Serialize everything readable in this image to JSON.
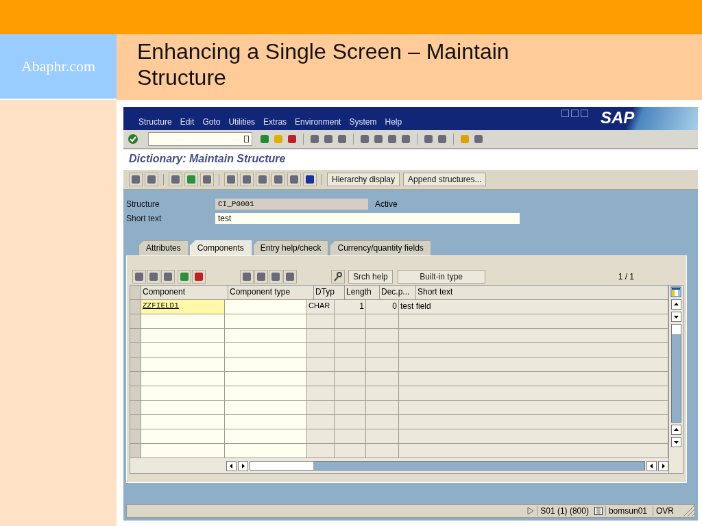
{
  "slide": {
    "site_label": "Abaphr.com",
    "title": "Enhancing a Single Screen – Maintain Structure"
  },
  "sap": {
    "menu": [
      "Structure",
      "Edit",
      "Goto",
      "Utilities",
      "Extras",
      "Environment",
      "System",
      "Help"
    ],
    "logo": "SAP",
    "screen_title": "Dictionary: Maintain Structure",
    "app_buttons": [
      "Hierarchy display",
      "Append structures..."
    ],
    "fields": [
      {
        "label": "Structure",
        "value": "CI_P0001",
        "kind": "readonly",
        "status": "Active"
      },
      {
        "label": "Short text",
        "value": "test",
        "kind": "input"
      }
    ],
    "tabs": [
      {
        "label": "Attributes",
        "selected": false
      },
      {
        "label": "Components",
        "selected": true
      },
      {
        "label": "Entry help/check",
        "selected": false
      },
      {
        "label": "Currency/quantity fields",
        "selected": false
      }
    ],
    "table_buttons": [
      "Srch help",
      "Built-in type"
    ],
    "page_counter": "1 / 1",
    "columns": [
      "Component",
      "Component type",
      "DTyp",
      "Length",
      "Dec.p...",
      "Short text"
    ],
    "rows": [
      [
        "ZZFIELD1",
        "",
        "CHAR",
        "1",
        "0",
        "test field"
      ]
    ],
    "status_bar": {
      "session": "S01 (1) (800)",
      "host": "bomsun01",
      "mode": "OVR"
    }
  }
}
